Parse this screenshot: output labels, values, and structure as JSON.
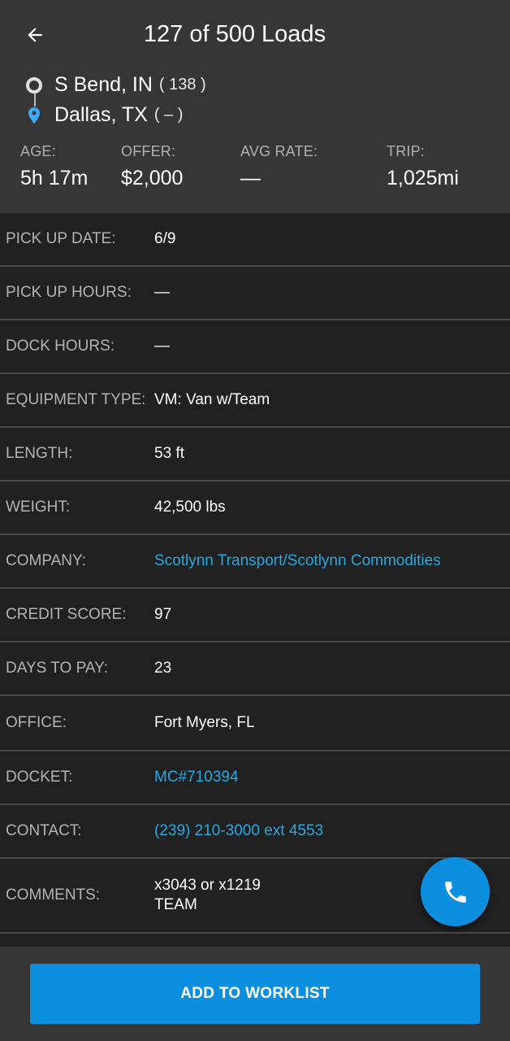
{
  "header": {
    "title": "127 of 500 Loads",
    "origin": {
      "city": "S Bend, IN",
      "count": "( 138 )"
    },
    "destination": {
      "city": "Dallas, TX",
      "count": "( – )"
    },
    "stats": [
      {
        "label": "AGE:",
        "value": "5h 17m"
      },
      {
        "label": "OFFER:",
        "value": "$2,000"
      },
      {
        "label": "AVG RATE:",
        "value": "—"
      },
      {
        "label": "TRIP:",
        "value": "1,025mi"
      }
    ]
  },
  "details": [
    {
      "label": "PICK UP DATE:",
      "value": "6/9"
    },
    {
      "label": "PICK UP HOURS:",
      "value": "—"
    },
    {
      "label": "DOCK HOURS:",
      "value": "—"
    },
    {
      "label": "EQUIPMENT TYPE:",
      "value": "VM: Van w/Team"
    },
    {
      "label": "LENGTH:",
      "value": "53 ft"
    },
    {
      "label": "WEIGHT:",
      "value": "42,500 lbs"
    },
    {
      "label": "COMPANY:",
      "value": "Scotlynn Transport/Scotlynn Commodities"
    },
    {
      "label": "CREDIT SCORE:",
      "value": "97"
    },
    {
      "label": "DAYS TO PAY:",
      "value": "23"
    },
    {
      "label": "OFFICE:",
      "value": "Fort Myers, FL"
    },
    {
      "label": "DOCKET:",
      "value": "MC#710394"
    },
    {
      "label": "CONTACT:",
      "value": "(239) 210-3000 ext 4553"
    },
    {
      "label": "COMMENTS:",
      "value": "x3043 or x1219\nTEAM"
    }
  ],
  "actions": {
    "add_to_worklist": "ADD TO WORKLIST"
  },
  "icons": {
    "back": "arrow-back-icon",
    "origin": "origin-circle-icon",
    "destination": "location-pin-icon",
    "call": "phone-icon"
  },
  "colors": {
    "accent": "#0d8fe0",
    "link": "#29a8e0",
    "header_bg": "#363636",
    "body_bg": "#212121"
  }
}
